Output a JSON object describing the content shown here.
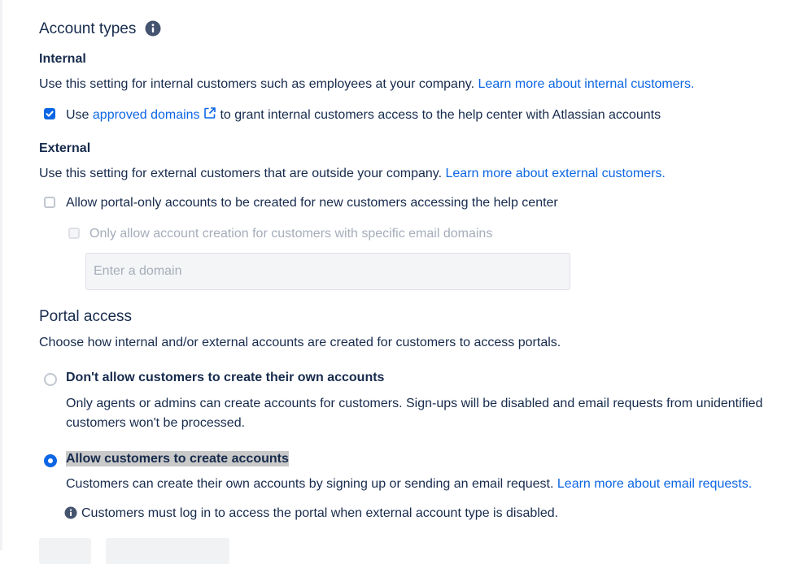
{
  "account_types": {
    "heading": "Account types",
    "info_icon": "info-icon",
    "internal": {
      "heading": "Internal",
      "description": "Use this setting for internal customers such as employees at your company.",
      "learn_more": "Learn more about internal customers.",
      "approved_domains": {
        "checked": true,
        "prefix": "Use",
        "link": "approved domains",
        "link_icon": "external-link-icon",
        "suffix": "to grant internal customers access to the help center with Atlassian accounts"
      }
    },
    "external": {
      "heading": "External",
      "description": "Use this setting for external customers that are outside your company.",
      "learn_more": "Learn more about external customers.",
      "portal_only": {
        "checked": false,
        "label": "Allow portal-only accounts to be created for new customers accessing the help center"
      },
      "specific_domains": {
        "checked": false,
        "disabled": true,
        "label": "Only allow account creation for customers with specific email domains"
      },
      "domain_input": {
        "placeholder": "Enter a domain",
        "value": ""
      }
    }
  },
  "portal_access": {
    "heading": "Portal access",
    "description": "Choose how internal and/or external accounts are created for customers to access portals.",
    "options": [
      {
        "label": "Don't allow customers to create their own accounts",
        "selected": false,
        "description": "Only agents or admins can create accounts for customers. Sign-ups will be disabled and email requests from unidentified customers won't be processed."
      },
      {
        "label": "Allow customers to create accounts",
        "selected": true,
        "description": "Customers can create their own accounts by signing up or sending an email request.",
        "learn_more": "Learn more about email requests."
      }
    ],
    "note": "Customers must log in to access the portal when external account type is disabled.",
    "note_icon": "info-icon"
  },
  "colors": {
    "text": "#172b4d",
    "link": "#0c66e4",
    "muted": "#a5adba",
    "checkbox_checked": "#0c66e4"
  }
}
